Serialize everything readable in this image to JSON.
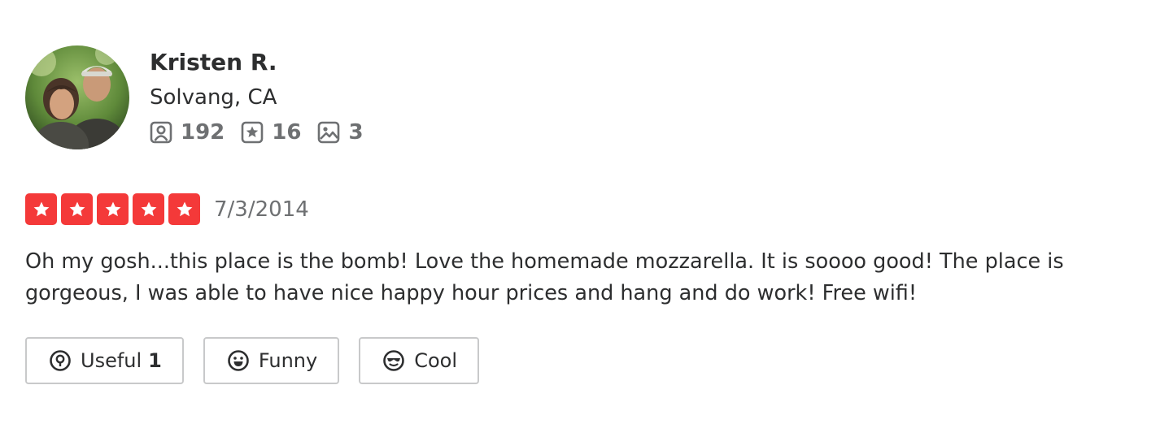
{
  "user": {
    "name": "Kristen R.",
    "location": "Solvang, CA",
    "avatar_icon": "user-photo",
    "stats": {
      "friends": {
        "icon": "friends-icon",
        "count": "192"
      },
      "reviews": {
        "icon": "review-star-icon",
        "count": "16"
      },
      "photos": {
        "icon": "photo-icon",
        "count": "3"
      }
    }
  },
  "review": {
    "rating": 5,
    "rating_max": 5,
    "date": "7/3/2014",
    "text": "Oh my gosh...this place is the bomb!  Love the homemade mozzarella.  It is soooo good!  The place is gorgeous, I was able to have nice happy hour prices and hang and do work!  Free wifi!"
  },
  "reactions": {
    "useful": {
      "label": "Useful",
      "count": "1",
      "icon": "lightbulb-icon"
    },
    "funny": {
      "label": "Funny",
      "icon": "laughing-face-icon"
    },
    "cool": {
      "label": "Cool",
      "icon": "sunglasses-face-icon"
    }
  },
  "colors": {
    "star_red": "#f43939",
    "text_dark": "#2d2e2f",
    "text_gray": "#6e7072",
    "button_border": "#c8c9ca"
  }
}
